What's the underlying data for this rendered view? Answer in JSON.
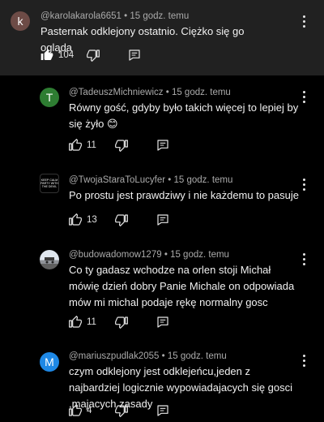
{
  "comments": [
    {
      "avatar_letter": "k",
      "avatar_color": "#6d4b46",
      "author": "@karolakarola6651",
      "separator": "•",
      "time": "15 godz. temu",
      "text": "Pasternak odklejony ostatnio. Ciężko się go ogląda",
      "likes": "104"
    },
    {
      "avatar_letter": "T",
      "avatar_color": "#2e7d32",
      "author": "@TadeuszMichniewicz",
      "separator": "•",
      "time": "15 godz. temu",
      "text": "Równy gość, gdyby było takich więcej to lepiej by się żyło 😊",
      "likes": "11"
    },
    {
      "avatar_text": "KEEP CALM PARTY WITH THE DEVIL",
      "author": "@TwojaStaraToLucyfer",
      "separator": "•",
      "time": "15 godz. temu",
      "text": "Po prostu jest prawdziwy i nie każdemu to pasuje",
      "likes": "13"
    },
    {
      "avatar_kind": "photo",
      "author": "@budowadomow1279",
      "separator": "•",
      "time": "15 godz. temu",
      "text": "Co ty gadasz wchodze na orlen stoji Michał mówię dzień dobry Panie Michale on odpowiada mów mi michal podaje rękę normalny gosc",
      "likes": "11"
    },
    {
      "avatar_letter": "M",
      "avatar_color": "#1e88e5",
      "author": "@mariuszpudlak2055",
      "separator": "•",
      "time": "15 godz. temu",
      "text": "czym odklejony jest odklejeńcu,jeden z najbardziej logicznie wypowiadajacych się gosci ,majacych zasady",
      "likes": "4"
    }
  ],
  "icons": {
    "like": "thumb-up-icon",
    "dislike": "thumb-down-icon",
    "reply": "reply-icon",
    "more": "more-vertical-icon"
  }
}
